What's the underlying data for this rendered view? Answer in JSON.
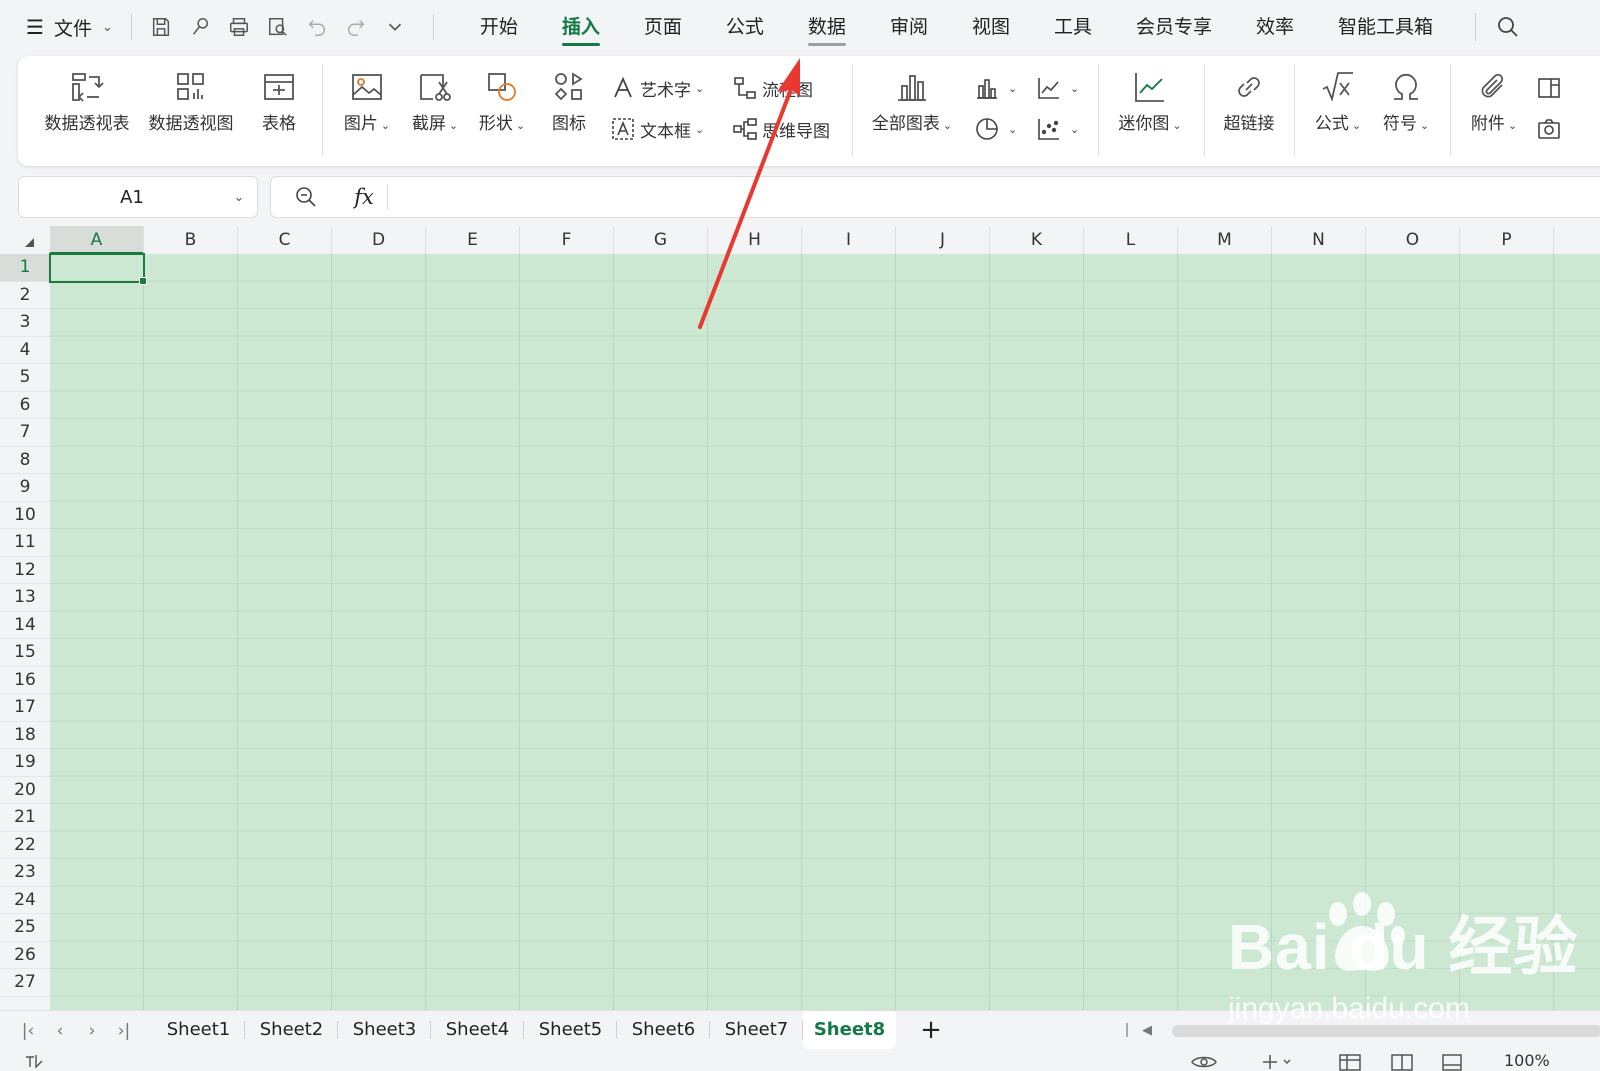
{
  "menubar": {
    "file_label": "文件",
    "tabs": [
      {
        "label": "开始"
      },
      {
        "label": "插入"
      },
      {
        "label": "页面"
      },
      {
        "label": "公式"
      },
      {
        "label": "数据"
      },
      {
        "label": "审阅"
      },
      {
        "label": "视图"
      },
      {
        "label": "工具"
      },
      {
        "label": "会员专享"
      },
      {
        "label": "效率"
      },
      {
        "label": "智能工具箱"
      }
    ],
    "active_tab": "插入",
    "hovered_tab": "数据"
  },
  "ribbon": {
    "pivot_table": "数据透视表",
    "pivot_chart": "数据透视图",
    "table": "表格",
    "picture": "图片",
    "screenshot": "截屏",
    "shapes": "形状",
    "icons": "图标",
    "wordart": "艺术字",
    "textbox": "文本框",
    "flowchart": "流程图",
    "mindmap": "思维导图",
    "all_charts": "全部图表",
    "sparkline": "迷你图",
    "hyperlink": "超链接",
    "formula": "公式",
    "symbol": "符号",
    "attachment": "附件"
  },
  "formula_bar": {
    "name_box": "A1",
    "fx_label": "fx",
    "content": ""
  },
  "grid": {
    "columns": [
      "A",
      "B",
      "C",
      "D",
      "E",
      "F",
      "G",
      "H",
      "I",
      "J",
      "K",
      "L",
      "M",
      "N",
      "O",
      "P"
    ],
    "rows": [
      "1",
      "2",
      "3",
      "4",
      "5",
      "6",
      "7",
      "8",
      "9",
      "10",
      "11",
      "12",
      "13",
      "14",
      "15",
      "16",
      "17",
      "18",
      "19",
      "20",
      "21",
      "22",
      "23",
      "24",
      "25",
      "26",
      "27"
    ],
    "selected_cell": "A1",
    "fill_color": "#cde8d2"
  },
  "sheets": {
    "tabs": [
      "Sheet1",
      "Sheet2",
      "Sheet3",
      "Sheet4",
      "Sheet5",
      "Sheet6",
      "Sheet7",
      "Sheet8"
    ],
    "active": "Sheet8",
    "add_label": "+"
  },
  "statusbar": {
    "zoom": "100%"
  },
  "watermark": {
    "logo_text": "Bai du 经验",
    "url": "jingyan.baidu.com"
  },
  "colors": {
    "accent": "#117a46",
    "annotation_arrow": "#e8382f"
  }
}
